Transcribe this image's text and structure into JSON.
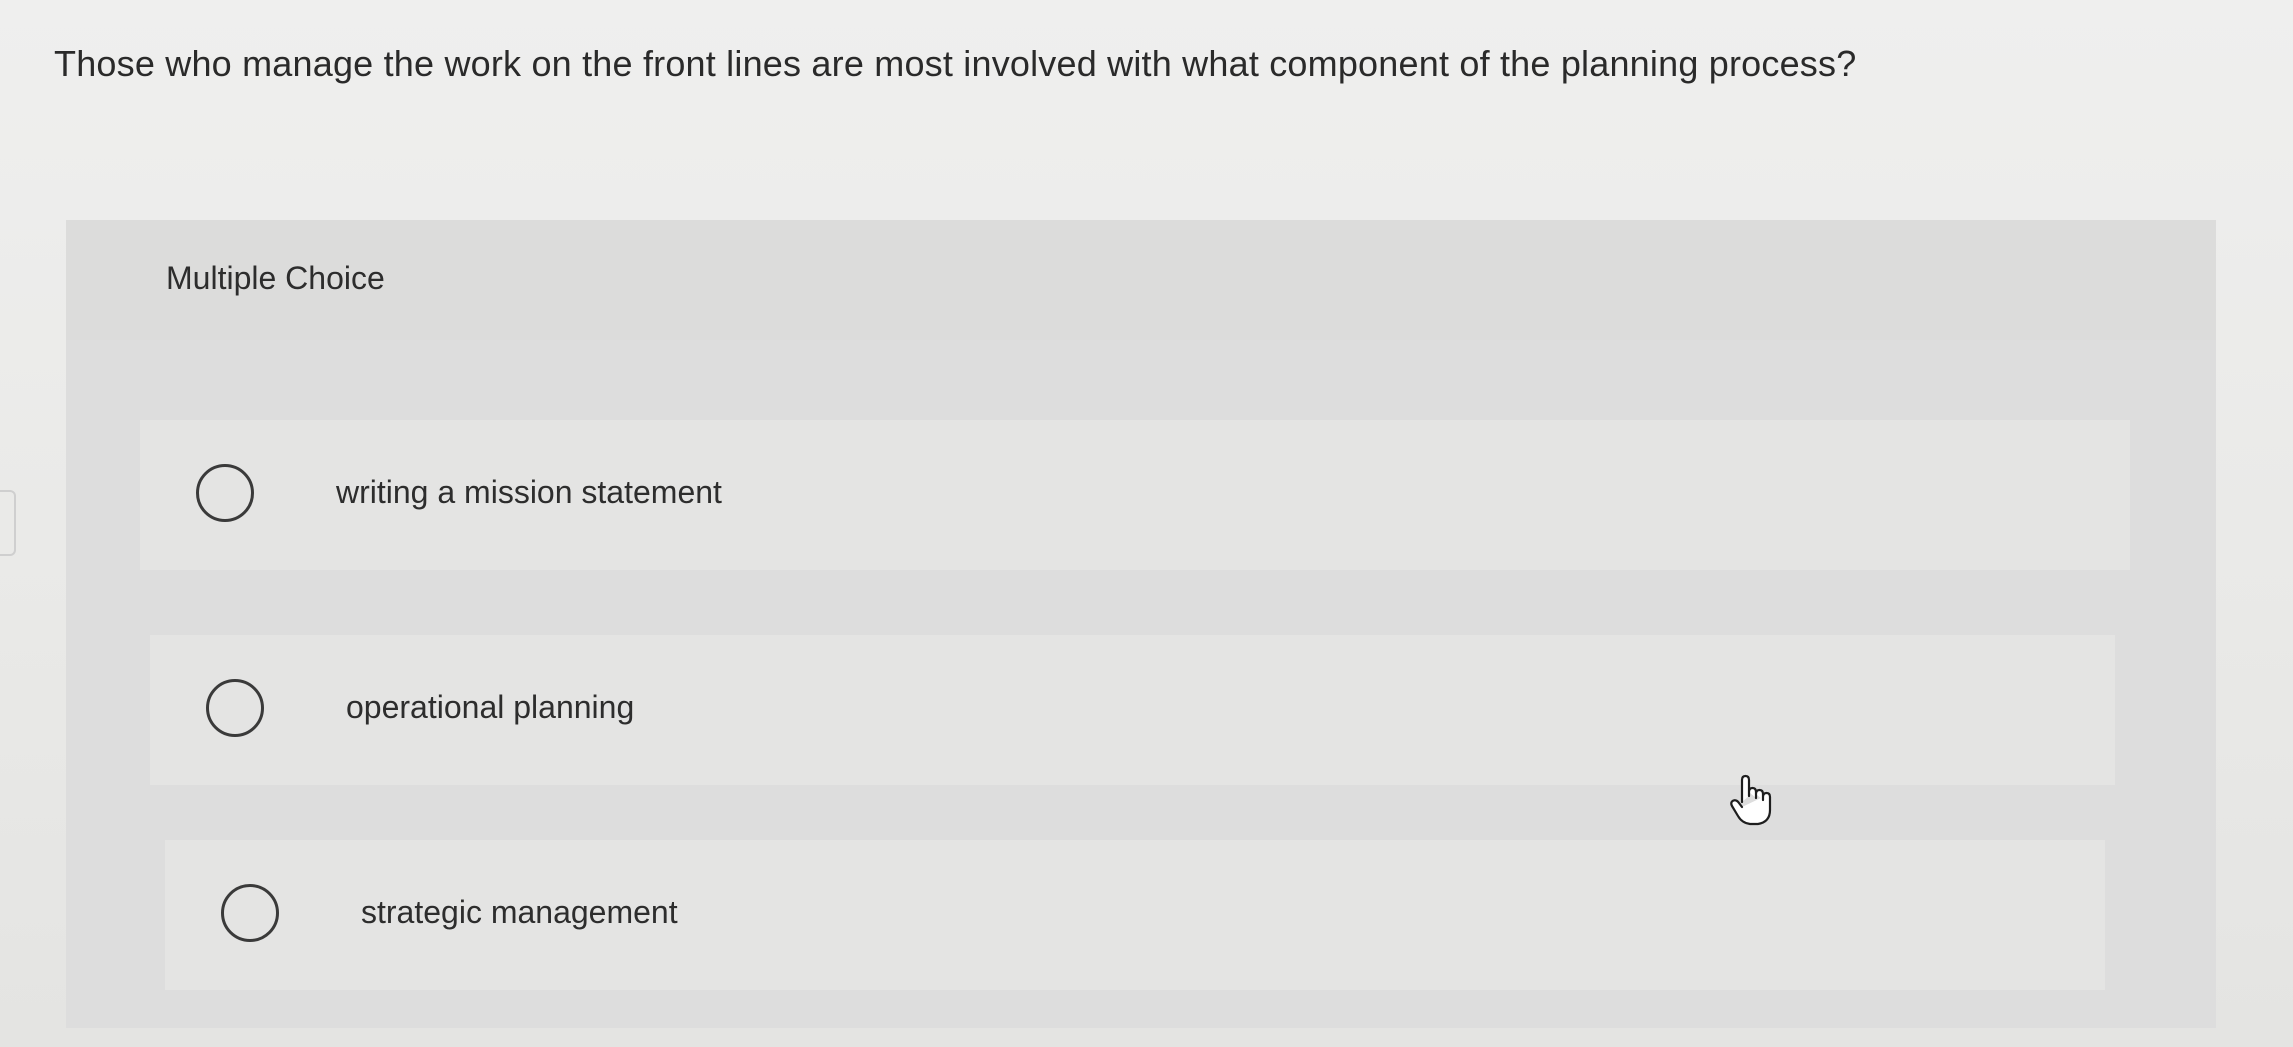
{
  "question": {
    "text": "Those who manage the work on the front lines are most involved with what component of the planning process?"
  },
  "multiple_choice": {
    "label": "Multiple Choice",
    "options": [
      {
        "label": "writing a mission statement"
      },
      {
        "label": "operational planning"
      },
      {
        "label": "strategic management"
      }
    ]
  },
  "colors": {
    "background": "#ebebea",
    "panel": "#dddddd",
    "option_card": "#e4e4e3",
    "text": "#2b2b2b"
  }
}
